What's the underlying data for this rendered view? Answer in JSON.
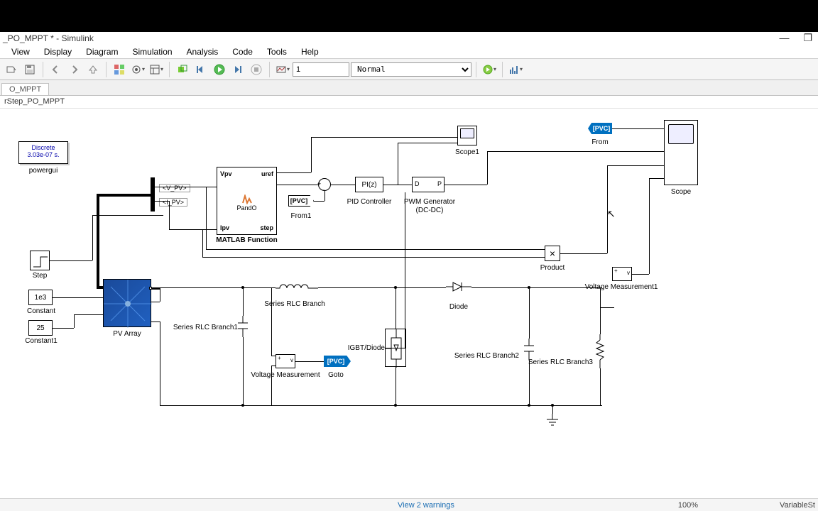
{
  "window": {
    "title": "_PO_MPPT * - Simulink",
    "minimize": "—",
    "maximize": "❐"
  },
  "menu": [
    "View",
    "Display",
    "Diagram",
    "Simulation",
    "Analysis",
    "Code",
    "Tools",
    "Help"
  ],
  "toolbar": {
    "stop_time": "1",
    "mode": "Normal"
  },
  "tab": "O_MPPT",
  "breadcrumb": "rStep_PO_MPPT",
  "blocks": {
    "powergui_l1": "Discrete",
    "powergui_l2": "3.03e-07 s.",
    "powergui": "powergui",
    "step": "Step",
    "constant_val": "1e3",
    "constant": "Constant",
    "constant1_val": "25",
    "constant1": "Constant1",
    "pvarray": "PV Array",
    "vpv_sel": "<V_PV>",
    "ipv_sel": "<I_PV>",
    "matlab_fn": "MATLAB Function",
    "matlab_name": "PandO",
    "mf_vpv": "Vpv",
    "mf_ipv": "Ipv",
    "mf_uref": "uref",
    "mf_step": "step",
    "pid_box": "PI(z)",
    "pid": "PID Controller",
    "pwm_d": "D",
    "pwm_p": "P",
    "pwm_l1": "PWM Generator",
    "pwm_l2": "(DC-DC)",
    "scope1": "Scope1",
    "scope": "Scope",
    "from1_tag": "[PVC]",
    "from1": "From1",
    "from_tag": "[PVC]",
    "from": "From",
    "prod_sym": "×",
    "product": "Product",
    "vm": "Voltage Measurement",
    "vm1": "Voltage Measurement1",
    "goto_tag": "[PVC]",
    "goto": "Goto",
    "srlc": "Series RLC Branch",
    "srlc1": "Series RLC Branch1",
    "srlc2": "Series RLC Branch2",
    "srlc3": "Series RLC Branch3",
    "diode": "Diode",
    "igbt": "IGBT/Diode"
  },
  "status": {
    "warnings": "View 2 warnings",
    "zoom": "100%",
    "solver": "VariableSt"
  }
}
